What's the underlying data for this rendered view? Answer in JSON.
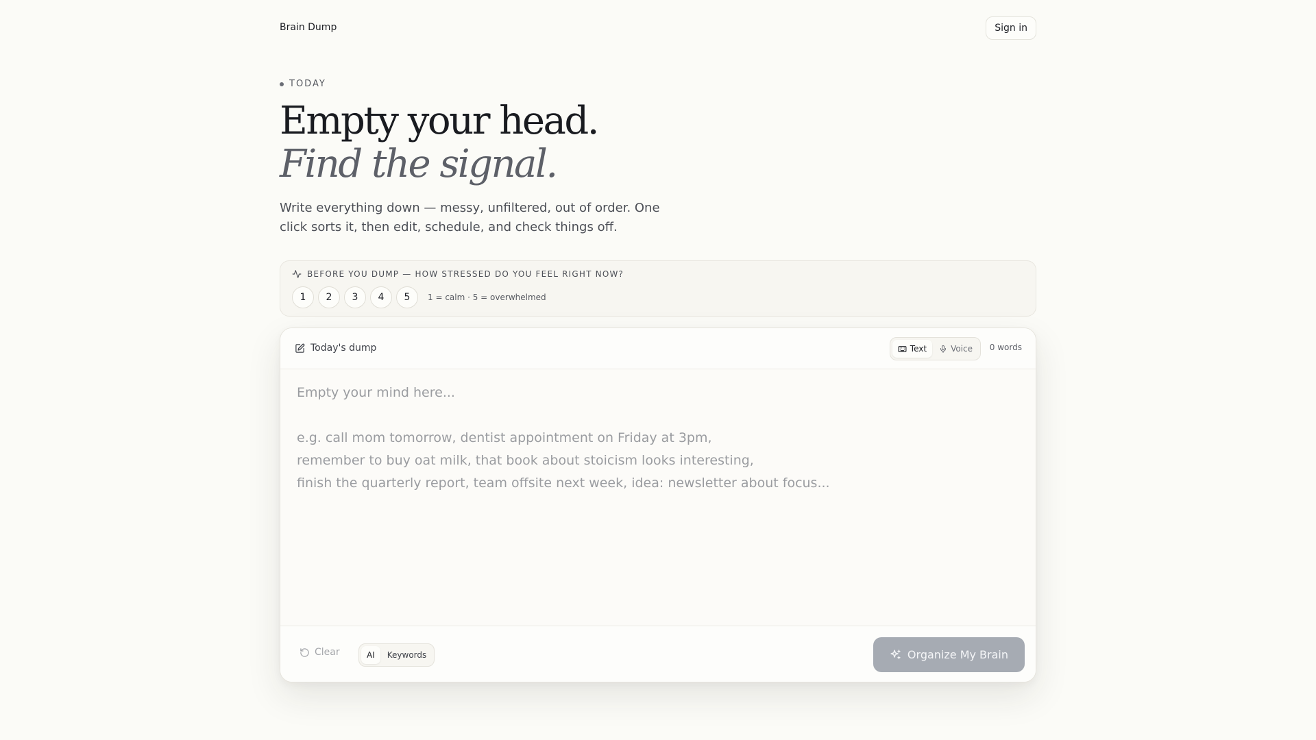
{
  "header": {
    "brand": "Brain Dump",
    "signin_label": "Sign in"
  },
  "hero": {
    "eyebrow": "TODAY",
    "title_line1": "Empty your head.",
    "title_line2": "Find the signal.",
    "subtitle": "Write everything down — messy, unfiltered, out of order. One click sorts it, then edit, schedule, and check things off."
  },
  "stress": {
    "question": "BEFORE YOU DUMP — HOW STRESSED DO YOU FEEL RIGHT NOW?",
    "options": [
      "1",
      "2",
      "3",
      "4",
      "5"
    ],
    "hint": "1 = calm · 5 = overwhelmed",
    "icon": "activity-icon"
  },
  "dump": {
    "title": "Today's dump",
    "title_icon": "edit-note-icon",
    "modes": [
      {
        "label": "Text",
        "icon": "keyboard-icon",
        "active": true
      },
      {
        "label": "Voice",
        "icon": "microphone-icon",
        "active": false
      }
    ],
    "word_count": "0 words",
    "value": "",
    "placeholder": "Empty your mind here...\n\ne.g. call mom tomorrow, dentist appointment on Friday at 3pm,\nremember to buy oat milk, that book about stoicism looks interesting,\nfinish the quarterly report, team offsite next week, idea: newsletter about focus..."
  },
  "footer": {
    "clear_label": "Clear",
    "clear_icon": "undo-icon",
    "sort_modes": [
      {
        "label": "AI",
        "active": true
      },
      {
        "label": "Keywords",
        "active": false
      }
    ],
    "organize_label": "Organize My Brain",
    "organize_icon": "sparkles-icon"
  },
  "colors": {
    "background": "#fbfbf7",
    "organize_button": "#a6abb3",
    "text_primary": "#1d1f24",
    "text_muted": "#5d6068"
  }
}
